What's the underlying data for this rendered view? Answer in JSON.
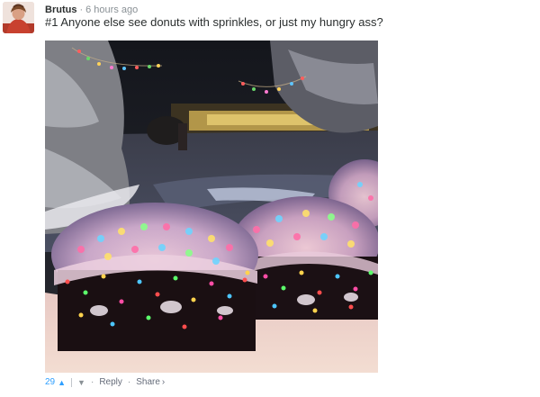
{
  "comment": {
    "author": "Brutus",
    "separator": "·",
    "time": "6 hours ago",
    "text": "#1 Anyone else see donuts with sprinkles, or just my hungry ass?"
  },
  "photo": {
    "subject": "snow-covered bushes wrapped in colorful Christmas lights at night"
  },
  "footer": {
    "votes": "29",
    "upvote_icon": "up-caret-icon",
    "downvote_icon": "down-caret-icon",
    "separator": "·",
    "reply_label": "Reply",
    "share_label": "Share",
    "share_icon": "chevron-right-icon"
  },
  "colors": {
    "text": "#2a2e2e",
    "muted": "#8a9196",
    "vote_blue": "#2e9fff",
    "link_gray": "#656c7a"
  }
}
